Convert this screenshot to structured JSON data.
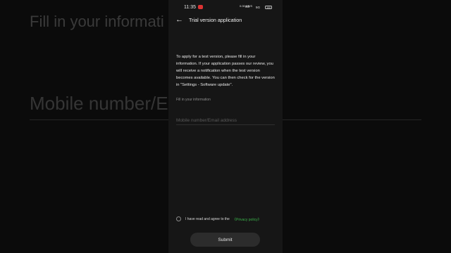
{
  "background": {
    "title": "Fill in your informati",
    "field": "Mobile number/Email address"
  },
  "status_bar": {
    "time": "11:35",
    "speed": "0.00 KB/S",
    "network": "5G",
    "signal": "5G",
    "battery": "100"
  },
  "header": {
    "back_icon": "arrow-left-icon",
    "title": "Trial version application"
  },
  "main": {
    "description": "To apply for a test version, please fill in your information. If your application passes our review, you will receive a notification when the test version becomes available. You can then check for the version in \"Settings - Software update\".",
    "section_label": "Fill in your information",
    "contact_input": {
      "value": "",
      "placeholder": "Mobile number/Email address"
    }
  },
  "agreement": {
    "text": "I have read and agree to the",
    "policy_link": "《Privacy policy》",
    "checked": false
  },
  "submit_label": "Submit",
  "colors": {
    "accent_link": "#3bb34a",
    "panel_bg": "#161616",
    "page_bg": "#0b0b0b"
  }
}
